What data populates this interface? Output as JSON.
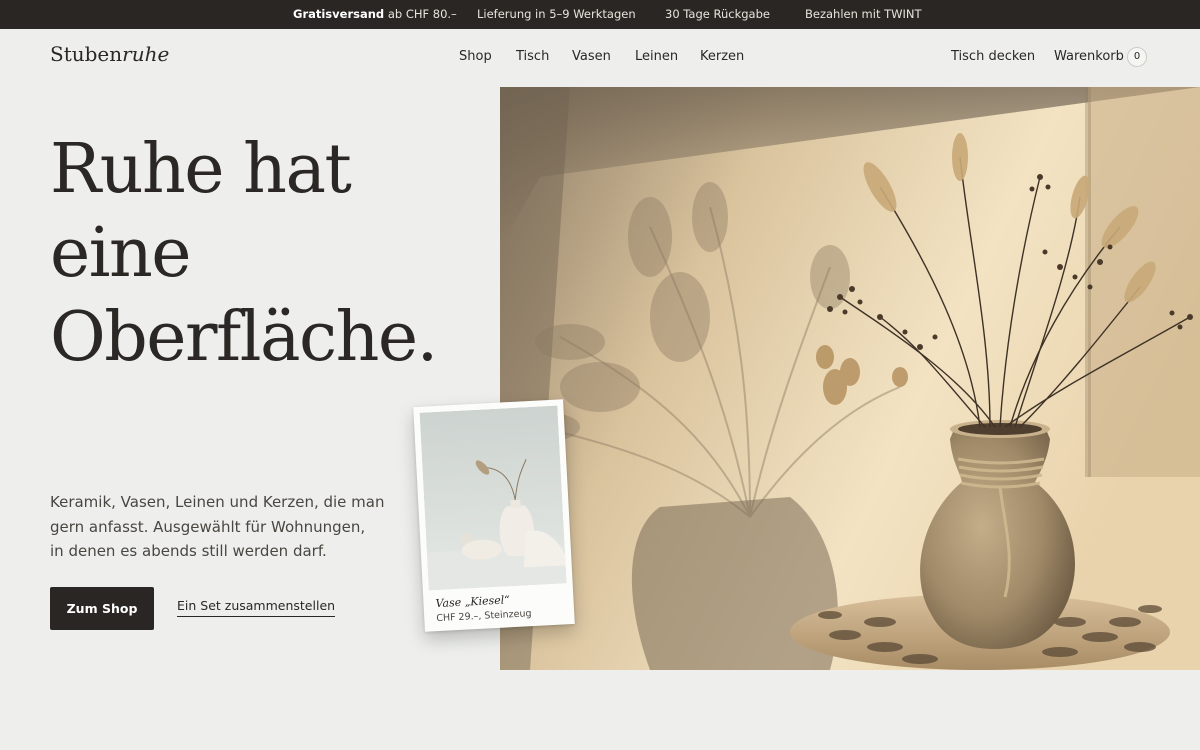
{
  "announcement": {
    "shipping_bold": "Gratisversand",
    "shipping_rest": "ab CHF 80.–",
    "delivery": "Lieferung in 5–9 Werktagen",
    "returns": "30 Tage Rückgabe",
    "payment": "Bezahlen mit TWINT"
  },
  "header": {
    "logo_main": "Stuben",
    "logo_italic": "ruhe",
    "nav": [
      "Shop",
      "Tisch",
      "Vasen",
      "Leinen",
      "Kerzen"
    ],
    "set_table": "Tisch decken",
    "cart_label": "Warenkorb",
    "cart_count": "0"
  },
  "hero": {
    "headline": [
      "Ruhe hat",
      "eine",
      "Oberfläche."
    ],
    "description": [
      "Keramik, Vasen, Leinen und Kerzen, die man",
      "gern anfasst. Ausgewählt für Wohnungen,",
      "in denen es abends still werden darf."
    ],
    "primary_button": "Zum Shop",
    "secondary_link": "Ein Set zusammenstellen"
  },
  "product_card": {
    "title": "Vase „Kiesel“",
    "subtitle": "CHF 29.–, Steinzeug"
  },
  "colors": {
    "background": "#eeefec",
    "dark": "#2a2623",
    "text": "#2a2724",
    "wall": "#efdcb8",
    "vase": "#a48d6d"
  }
}
